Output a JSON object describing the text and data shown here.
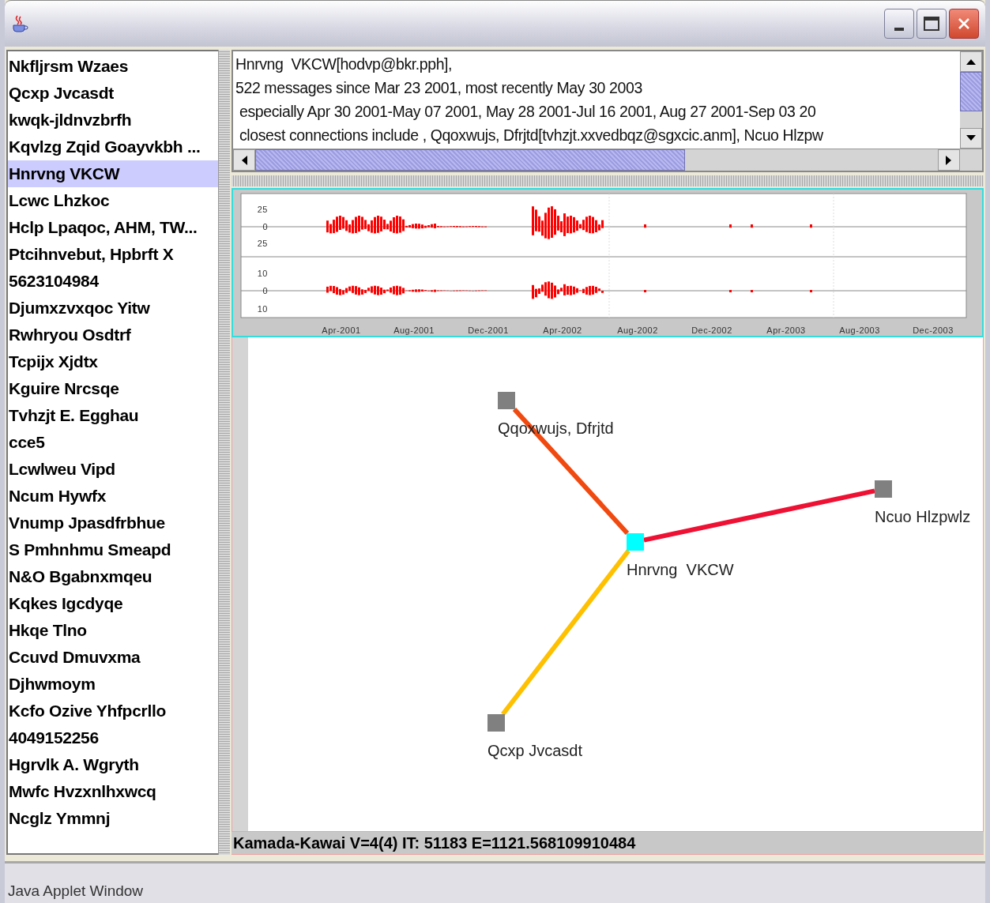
{
  "contacts": [
    {
      "name": "Nkfljrsm Wzaes",
      "selected": false
    },
    {
      "name": "Qcxp Jvcasdt",
      "selected": false
    },
    {
      "name": "kwqk-jldnvzbrfh",
      "selected": false
    },
    {
      "name": "Kqvlzg Zqid Goayvkbh ...",
      "selected": false
    },
    {
      "name": "Hnrvng  VKCW",
      "selected": true
    },
    {
      "name": "Lcwc Lhzkoc",
      "selected": false
    },
    {
      "name": "Hclp Lpaqoc, AHM, TW...",
      "selected": false
    },
    {
      "name": "Ptcihnvebut, Hpbrft X",
      "selected": false
    },
    {
      "name": "5623104984",
      "selected": false
    },
    {
      "name": "Djumxzvxqoc Yitw",
      "selected": false
    },
    {
      "name": "Rwhryou Osdtrf",
      "selected": false
    },
    {
      "name": "Tcpijx Xjdtx",
      "selected": false
    },
    {
      "name": "Kguire Nrcsqe",
      "selected": false
    },
    {
      "name": "Tvhzjt E. Egghau",
      "selected": false
    },
    {
      "name": "cce5",
      "selected": false
    },
    {
      "name": "Lcwlweu Vipd",
      "selected": false
    },
    {
      "name": "Ncum Hywfx",
      "selected": false
    },
    {
      "name": "Vnump Jpasdfrbhue",
      "selected": false
    },
    {
      "name": "S Pmhnhmu Smeapd",
      "selected": false
    },
    {
      "name": "N&O Bgabnxmqeu",
      "selected": false
    },
    {
      "name": "Kqkes Igcdyqe",
      "selected": false
    },
    {
      "name": "Hkqe Tlno",
      "selected": false
    },
    {
      "name": "Ccuvd Dmuvxma",
      "selected": false
    },
    {
      "name": "Djhwmoym",
      "selected": false
    },
    {
      "name": "Kcfo Ozive Yhfpcrllo",
      "selected": false
    },
    {
      "name": "4049152256",
      "selected": false
    },
    {
      "name": "Hgrvlk A. Wgryth",
      "selected": false
    },
    {
      "name": "Mwfc Hvzxnlhxwcq",
      "selected": false
    },
    {
      "name": "Ncglz Ymmnj",
      "selected": false
    }
  ],
  "details": {
    "lines": [
      "Hnrvng  VKCW[hodvp@bkr.pph],",
      "522 messages since Mar 23 2001, most recently May 30 2003",
      " especially Apr 30 2001-May 07 2001, May 28 2001-Jul 16 2001, Aug 27 2001-Sep 03 20",
      " closest connections include , Qqoxwujs, Dfrjtd[tvhzjt.xxvedbqz@sgxcic.anm], Ncuo Hlzpw"
    ]
  },
  "chart": {
    "upper_ticks": [
      "25",
      "0",
      "25"
    ],
    "lower_ticks": [
      "10",
      "0",
      "10"
    ],
    "x_labels": [
      "Apr-2001",
      "Aug-2001",
      "Dec-2001",
      "Apr-2002",
      "Aug-2002",
      "Dec-2002",
      "Apr-2003",
      "Aug-2003",
      "Dec-2003"
    ]
  },
  "graph": {
    "nodes": [
      {
        "label": "Qqoxwujs, Dfrjtd",
        "selected": false,
        "color": "#f04a10"
      },
      {
        "label": "Hnrvng  VKCW",
        "selected": true
      },
      {
        "label": "Ncuo Hlzpwlz",
        "selected": false,
        "color": "#ee1133"
      },
      {
        "label": "Qcxp Jvcasdt",
        "selected": false,
        "color": "#ffc000"
      }
    ],
    "layout_status": "Kamada-Kawai V=4(4) IT: 51183 E=1121.568109910484"
  },
  "status_bar": "Java Applet Window"
}
